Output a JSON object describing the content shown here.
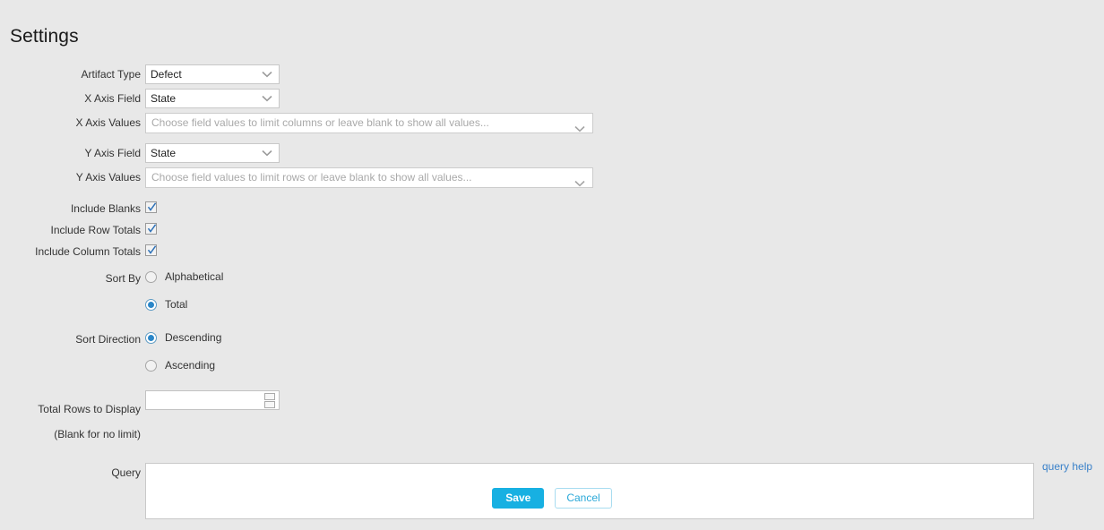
{
  "page": {
    "title": "Settings",
    "background_color": "#e8e8e8"
  },
  "colors": {
    "accent": "#17b0e2",
    "link": "#3a81c9",
    "checkmark": "#2f72b8",
    "radio_selected": "#2a86c8",
    "cancel_border": "#a8dcf0",
    "cancel_text": "#2aa8d8"
  },
  "form": {
    "artifact_type": {
      "label": "Artifact Type",
      "value": "Defect",
      "icon": "chevron-down-icon"
    },
    "x_axis_field": {
      "label": "X Axis Field",
      "value": "State",
      "icon": "chevron-down-icon"
    },
    "x_axis_values": {
      "label": "X Axis Values",
      "value": "",
      "placeholder": "Choose field values to limit columns or leave blank to show all values...",
      "icon": "chevron-down-icon"
    },
    "y_axis_field": {
      "label": "Y Axis Field",
      "value": "State",
      "icon": "chevron-down-icon"
    },
    "y_axis_values": {
      "label": "Y Axis Values",
      "value": "",
      "placeholder": "Choose field values to limit rows or leave blank to show all values...",
      "icon": "chevron-down-icon"
    },
    "include_blanks": {
      "label": "Include Blanks",
      "checked": true
    },
    "include_row_totals": {
      "label": "Include Row Totals",
      "checked": true
    },
    "include_column_totals": {
      "label": "Include Column Totals",
      "checked": true
    },
    "sort_by": {
      "label": "Sort By",
      "options": [
        {
          "label": "Alphabetical",
          "selected": false
        },
        {
          "label": "Total",
          "selected": true
        }
      ]
    },
    "sort_direction": {
      "label": "Sort Direction",
      "options": [
        {
          "label": "Descending",
          "selected": true
        },
        {
          "label": "Ascending",
          "selected": false
        }
      ]
    },
    "total_rows": {
      "label_line1": "Total Rows to Display",
      "label_line2": "(Blank for no limit)",
      "value": "",
      "placeholder": ""
    },
    "query": {
      "label": "Query",
      "value": "",
      "placeholder": "",
      "help_link": "query help"
    }
  },
  "actions": {
    "save_label": "Save",
    "cancel_label": "Cancel"
  }
}
